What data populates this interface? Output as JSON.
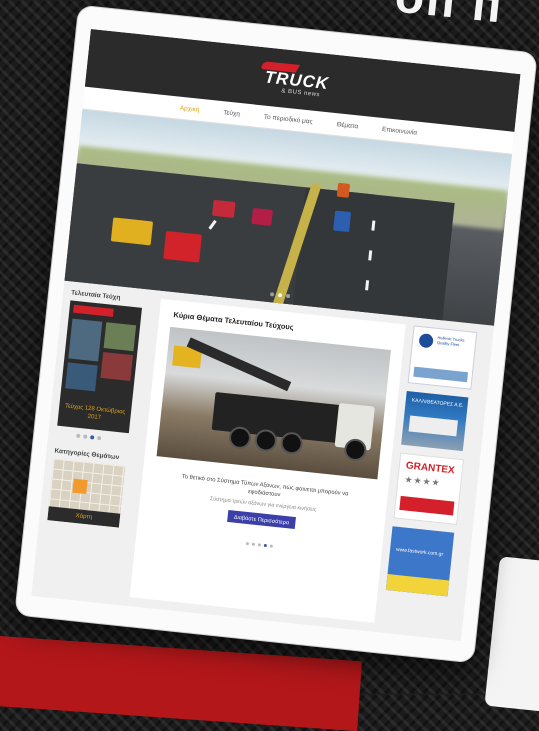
{
  "background": {
    "headline_fragment": "оп п",
    "colors": {
      "accent_red": "#b3171a",
      "carbon": "#1c1c1c"
    }
  },
  "site": {
    "logo": {
      "main": "TRUCK",
      "sub": "& BUS news"
    },
    "nav": {
      "items": [
        {
          "label": "Αρχική",
          "active": true
        },
        {
          "label": "Τεύχη",
          "active": false
        },
        {
          "label": "Το περιοδικό μας",
          "active": false
        },
        {
          "label": "Θέματα",
          "active": false
        },
        {
          "label": "Επικοινωνία",
          "active": false
        }
      ]
    },
    "slider": {
      "active_slide": 1,
      "slide_count": 3
    },
    "sidebar_left": {
      "issues_title": "Τελευταία Τεύχη",
      "cover_label": "Τεύχος 128 Οκτώβριος 2017",
      "issue_dots_active": 2,
      "issue_dots_count": 4,
      "topics_title": "Κατηγορίες Θεμάτων",
      "map_button": "Χάρτη"
    },
    "center": {
      "title": "Κύρια Θέματα Τελευταίου Τεύχους",
      "caption": "Το θετικό στο Σύστημα Τύπων Αξόνων, πώς φαινεται μπορούν να εφοδιάστουν",
      "subcaption": "Σύστημα τρεών αξόνων για ενέργεια κινήσεις",
      "cta_label": "Διαβάστε Περισσότερα",
      "dots_active": 4,
      "dots_count": 5
    },
    "sidebar_right": {
      "ad_1_text": "Hellenic Trucks Quality Fleet",
      "ad_2_text": "ΚΑΛΛΙΘΕΑΤΟΡΕΣ Α.Ε.",
      "ad_3_brand": "GRANTEX",
      "ad_3_stars": "★★★★",
      "ad_4_text": "www.fastwork.com.gr"
    }
  }
}
